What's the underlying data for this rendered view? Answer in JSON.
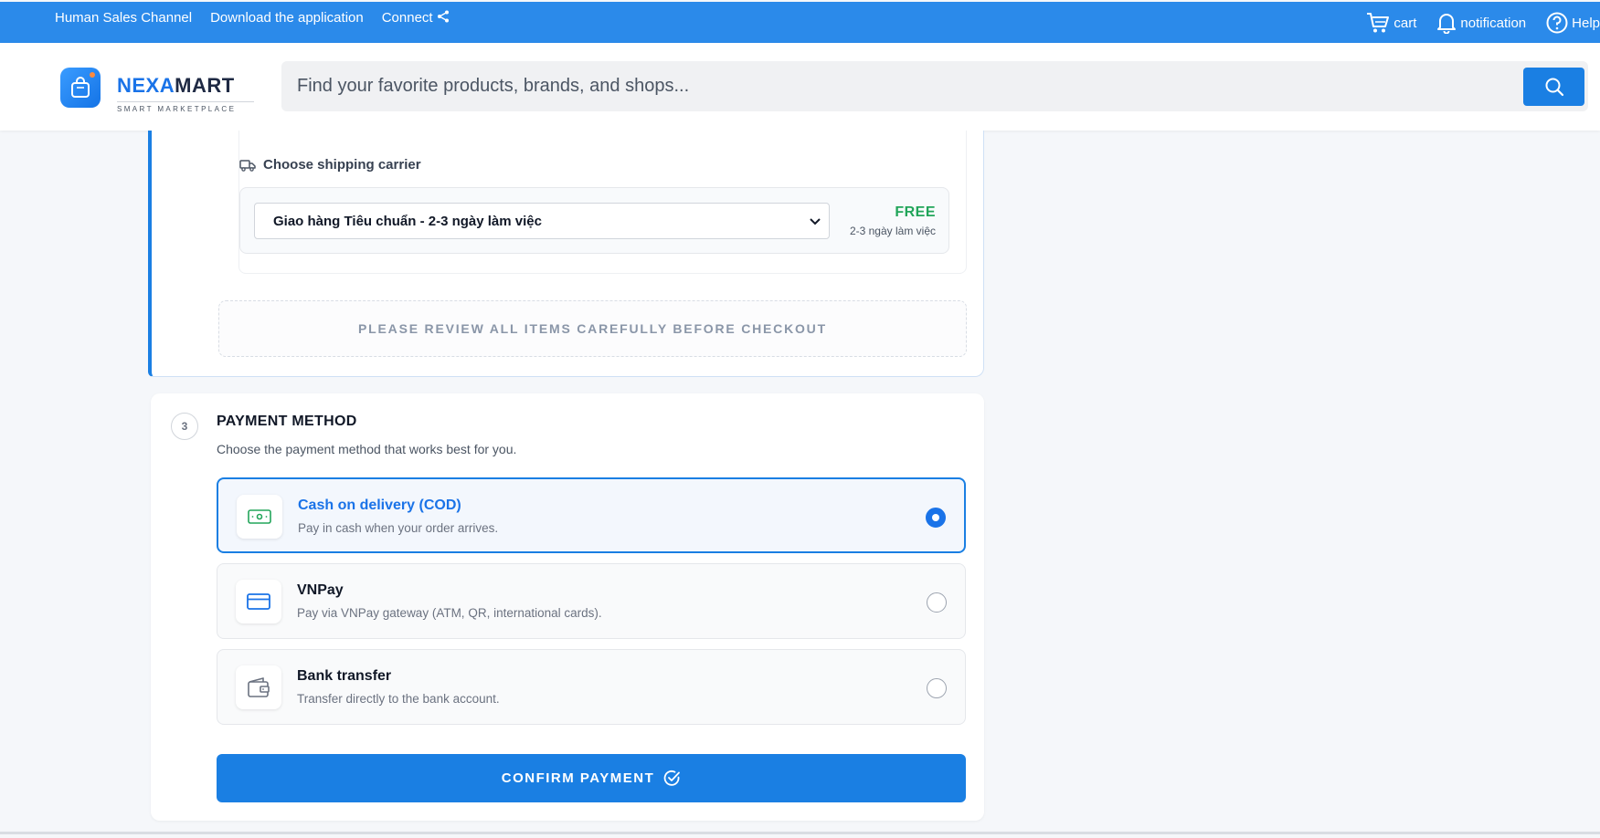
{
  "topbar": {
    "human_sales": "Human Sales Channel",
    "download": "Download the application",
    "connect": "Connect",
    "cart": "cart",
    "notification": "notification",
    "help": "Help"
  },
  "header": {
    "brand_part1": "NEXA",
    "brand_part2": "MART",
    "tagline": "SMART MARKETPLACE",
    "search_placeholder": "Find your favorite products, brands, and shops..."
  },
  "shipping": {
    "title": "Choose shipping carrier",
    "selected_carrier": "Giao hàng Tiêu chuẩn - 2-3 ngày làm việc",
    "price": "FREE",
    "days": "2-3 ngày làm việc",
    "review_notice": "PLEASE REVIEW ALL ITEMS CAREFULLY BEFORE CHECKOUT"
  },
  "payment": {
    "step": "3",
    "title": "PAYMENT METHOD",
    "subtitle": "Choose the payment method that works best for you.",
    "options": [
      {
        "name": "Cash on delivery (COD)",
        "desc": "Pay in cash when your order arrives.",
        "selected": true
      },
      {
        "name": "VNPay",
        "desc": "Pay via VNPay gateway (ATM, QR, international cards).",
        "selected": false
      },
      {
        "name": "Bank transfer",
        "desc": "Transfer directly to the bank account.",
        "selected": false
      }
    ],
    "confirm_label": "CONFIRM PAYMENT"
  },
  "colors": {
    "primary": "#1a7fe3",
    "topbar": "#2b8aea",
    "success": "#22a55a"
  }
}
